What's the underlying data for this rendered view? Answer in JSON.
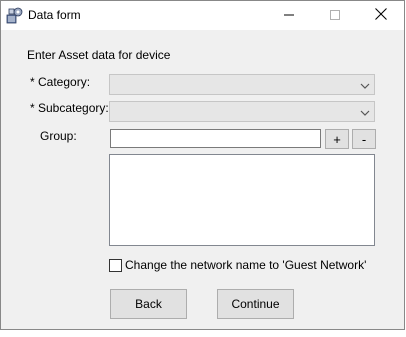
{
  "window": {
    "title": "Data form",
    "icon": "app-gears-icon",
    "controls": {
      "minimize": "minimize-icon",
      "maximize": "maximize-icon",
      "close": "close-icon"
    }
  },
  "form": {
    "heading": "Enter Asset data for device",
    "category_label": "* Category:",
    "category_value": "",
    "subcategory_label": "* Subcategory:",
    "subcategory_value": "",
    "group_label": "Group:",
    "group_value": "",
    "group_add": "+",
    "group_remove": "-",
    "network_checkbox_label": "Change the network name to 'Guest Network'",
    "network_checkbox_checked": false
  },
  "buttons": {
    "back": "Back",
    "continue": "Continue"
  },
  "colors": {
    "window_bg": "#f0f0f0",
    "titlebar_bg": "#ffffff",
    "button_bg": "#e1e1e1",
    "combo_bg": "#e6e6e6"
  }
}
